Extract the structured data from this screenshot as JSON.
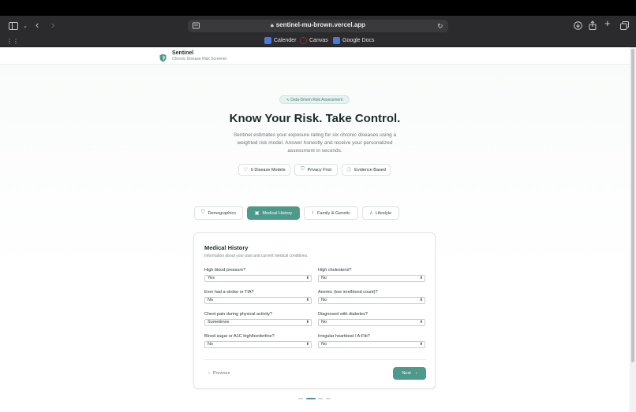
{
  "browser": {
    "url": "sentinel-mu-brown.vercel.app",
    "bookmarks": [
      {
        "label": "Calender",
        "icon": "calendar-icon",
        "color": "#4a7bd8"
      },
      {
        "label": "Canvas",
        "icon": "canvas-icon",
        "color": "#d8443b"
      },
      {
        "label": "Google Docs",
        "icon": "docs-icon",
        "color": "#4a7bd8"
      }
    ]
  },
  "app": {
    "name": "Sentinel",
    "tagline": "Chronic Disease Risk Screener",
    "accent": "#4e9a8a"
  },
  "hero": {
    "pill": "Data-Driven Risk Assessment",
    "title": "Know Your Risk. Take Control.",
    "subtitle": "Sentinel estimates your exposure rating for six chronic diseases using a weighted risk model. Answer honestly and receive your personalized assessment in seconds.",
    "badges": [
      {
        "label": "6 Disease Models",
        "icon": "heart-icon"
      },
      {
        "label": "Privacy First",
        "icon": "shield-icon"
      },
      {
        "label": "Evidence Based",
        "icon": "info-icon"
      }
    ]
  },
  "tabs": [
    {
      "label": "Demographics",
      "icon": "shield-icon",
      "active": false
    },
    {
      "label": "Medical History",
      "icon": "clipboard-icon",
      "active": true
    },
    {
      "label": "Family & Genetic",
      "icon": "dna-icon",
      "active": false
    },
    {
      "label": "Lifestyle",
      "icon": "run-icon",
      "active": false
    }
  ],
  "form": {
    "title": "Medical History",
    "subtitle": "Information about your past and current medical conditions.",
    "questions": [
      {
        "label": "High blood pressure?",
        "value": "Yes"
      },
      {
        "label": "High cholesterol?",
        "value": "No"
      },
      {
        "label": "Ever had a stroke or TIA?",
        "value": "No"
      },
      {
        "label": "Anemic (low iron/blood count)?",
        "value": "No"
      },
      {
        "label": "Chest pain during physical activity?",
        "value": "Sometimes"
      },
      {
        "label": "Diagnosed with diabetes?",
        "value": "No"
      },
      {
        "label": "Blood sugar or A1C high/borderline?",
        "value": "No"
      },
      {
        "label": "Irregular heartbeat / A-Fib?",
        "value": "No"
      }
    ],
    "prev_label": "Previous",
    "next_label": "Next"
  },
  "progress": {
    "steps": 4,
    "current": 2
  }
}
